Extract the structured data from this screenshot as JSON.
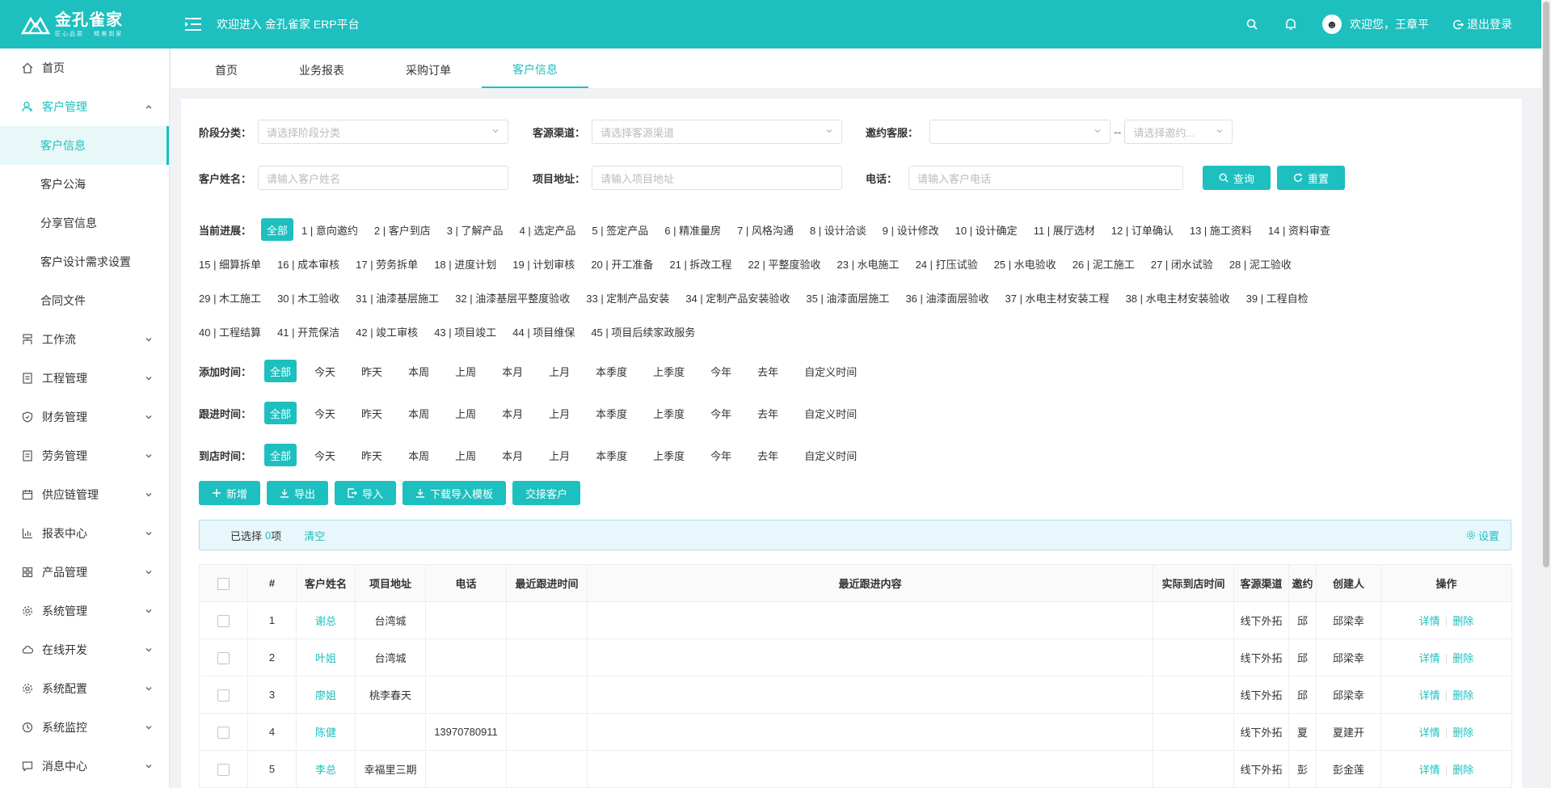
{
  "header": {
    "logo_text": "金孔雀家",
    "logo_slogan": "匠心品质 · 精美到家",
    "welcome": "欢迎进入 金孔雀家 ERP平台",
    "user_greeting": "欢迎您，王章平",
    "logout": "退出登录",
    "accent": "#1ebfbf"
  },
  "sidebar": {
    "items": [
      {
        "label": "首页",
        "icon": "home-icon"
      },
      {
        "label": "客户管理",
        "icon": "user-icon"
      },
      {
        "label": "工作流",
        "icon": "flow-icon"
      },
      {
        "label": "工程管理",
        "icon": "doc-icon"
      },
      {
        "label": "财务管理",
        "icon": "shield-icon"
      },
      {
        "label": "劳务管理",
        "icon": "doc-icon"
      },
      {
        "label": "供应链管理",
        "icon": "calendar-icon"
      },
      {
        "label": "报表中心",
        "icon": "chart-icon"
      },
      {
        "label": "产品管理",
        "icon": "grid-icon"
      },
      {
        "label": "系统管理",
        "icon": "gear-icon"
      },
      {
        "label": "在线开发",
        "icon": "cloud-icon"
      },
      {
        "label": "系统配置",
        "icon": "gear-icon"
      },
      {
        "label": "系统监控",
        "icon": "clock-icon"
      },
      {
        "label": "消息中心",
        "icon": "message-icon"
      }
    ],
    "sub_items": [
      "客户信息",
      "客户公海",
      "分享官信息",
      "客户设计需求设置",
      "合同文件"
    ]
  },
  "tabs": [
    "首页",
    "业务报表",
    "采购订单",
    "客户信息"
  ],
  "filters": {
    "stage_label": "阶段分类：",
    "stage_placeholder": "请选择阶段分类",
    "source_label": "客源渠道：",
    "source_placeholder": "请选择客源渠道",
    "invite_label": "邀约客服：",
    "invite_placeholder": "",
    "invite_dash": "--",
    "invite_placeholder2": "请选择邀约...",
    "name_label": "客户姓名：",
    "name_placeholder": "请输入客户姓名",
    "address_label": "项目地址：",
    "address_placeholder": "请输入项目地址",
    "phone_label": "电话：",
    "phone_placeholder": "请输入客户电话",
    "query_btn": "查询",
    "reset_btn": "重置"
  },
  "progress": {
    "label": "当前进展：",
    "rows": [
      [
        "全部",
        "1 | 意向邀约",
        "2 | 客户到店",
        "3 | 了解产品",
        "4 | 选定产品",
        "5 | 签定产品",
        "6 | 精准量房",
        "7 | 风格沟通",
        "8 | 设计洽谈",
        "9 | 设计修改",
        "10 | 设计确定",
        "11 | 展厅选材",
        "12 | 订单确认",
        "13 | 施工资料",
        "14 | 资料审查"
      ],
      [
        "15 | 细算拆单",
        "16 | 成本审核",
        "17 | 劳务拆单",
        "18 | 进度计划",
        "19 | 计划审核",
        "20 | 开工准备",
        "21 | 拆改工程",
        "22 | 平整度验收",
        "23 | 水电施工",
        "24 | 打压试验",
        "25 | 水电验收",
        "26 | 泥工施工",
        "27 | 闭水试验",
        "28 | 泥工验收"
      ],
      [
        "29 | 木工施工",
        "30 | 木工验收",
        "31 | 油漆基层施工",
        "32 | 油漆基层平整度验收",
        "33 | 定制产品安装",
        "34 | 定制产品安装验收",
        "35 | 油漆面层施工",
        "36 | 油漆面层验收",
        "37 | 水电主材安装工程",
        "38 | 水电主材安装验收",
        "39 | 工程自检"
      ],
      [
        "40 | 工程结算",
        "41 | 开荒保洁",
        "42 | 竣工审核",
        "43 | 项目竣工",
        "44 | 项目维保",
        "45 | 项目后续家政服务"
      ]
    ]
  },
  "time_filters": [
    {
      "label": "添加时间：",
      "options": [
        "全部",
        "今天",
        "昨天",
        "本周",
        "上周",
        "本月",
        "上月",
        "本季度",
        "上季度",
        "今年",
        "去年",
        "自定义时间"
      ]
    },
    {
      "label": "跟进时间：",
      "options": [
        "全部",
        "今天",
        "昨天",
        "本周",
        "上周",
        "本月",
        "上月",
        "本季度",
        "上季度",
        "今年",
        "去年",
        "自定义时间"
      ]
    },
    {
      "label": "到店时间：",
      "options": [
        "全部",
        "今天",
        "昨天",
        "本周",
        "上周",
        "本月",
        "上月",
        "本季度",
        "上季度",
        "今年",
        "去年",
        "自定义时间"
      ]
    }
  ],
  "actions": {
    "add": "新增",
    "export": "导出",
    "import": "导入",
    "download_template": "下载导入模板",
    "transfer": "交接客户"
  },
  "selection": {
    "prefix": "已选择",
    "count": "0",
    "suffix": "项",
    "clear": "清空",
    "settings": "设置"
  },
  "table": {
    "columns": [
      "#",
      "客户姓名",
      "项目地址",
      "电话",
      "最近跟进时间",
      "最近跟进内容",
      "实际到店时间",
      "客源渠道",
      "邀约",
      "创建人",
      "操作"
    ],
    "detail": "详情",
    "delete": "删除",
    "rows": [
      {
        "no": "1",
        "name": "谢总",
        "address": "台湾城",
        "phone": "",
        "source": "线下外拓",
        "invite": "邱",
        "creator": "邱梁幸"
      },
      {
        "no": "2",
        "name": "叶姐",
        "address": "台湾城",
        "phone": "",
        "source": "线下外拓",
        "invite": "邱",
        "creator": "邱梁幸"
      },
      {
        "no": "3",
        "name": "廖姐",
        "address": "桃李春天",
        "phone": "",
        "source": "线下外拓",
        "invite": "邱",
        "creator": "邱梁幸"
      },
      {
        "no": "4",
        "name": "陈健",
        "address": "",
        "phone": "13970780911",
        "source": "线下外拓",
        "invite": "夏",
        "creator": "夏建开"
      },
      {
        "no": "5",
        "name": "李总",
        "address": "幸福里三期",
        "phone": "",
        "source": "线下外拓",
        "invite": "彭",
        "creator": "彭金莲"
      }
    ]
  }
}
